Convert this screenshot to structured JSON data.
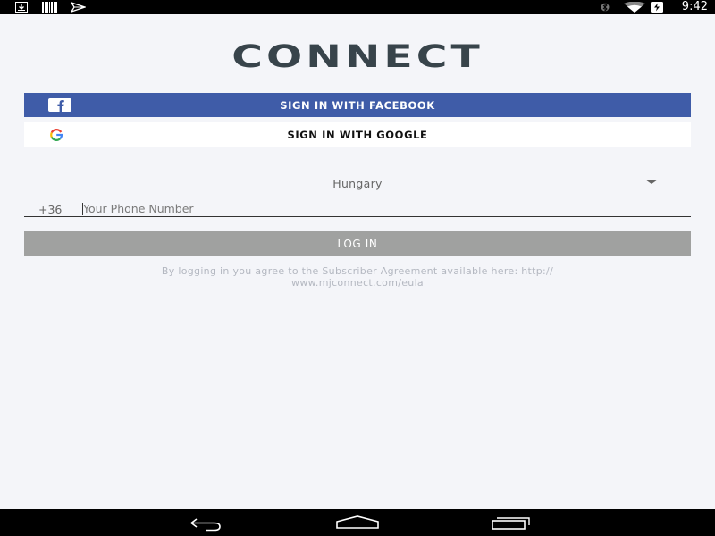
{
  "status_bar": {
    "time": "9:42",
    "left_icons": [
      "download-icon",
      "barcode-icon",
      "send-icon"
    ],
    "right_icons": [
      "bluetooth-icon",
      "wifi-icon",
      "battery-charging-icon"
    ]
  },
  "logo": {
    "text": "CONNECT"
  },
  "facebook_button": {
    "label": "SIGN IN WITH FACEBOOK",
    "icon": "facebook-icon",
    "color": "#3f5ca8"
  },
  "google_button": {
    "label": "SIGN IN WITH GOOGLE",
    "icon": "google-icon"
  },
  "country_select": {
    "value": "Hungary"
  },
  "phone": {
    "dial_code": "+36",
    "placeholder": "Your Phone Number",
    "value": ""
  },
  "login_button": {
    "label": "LOG IN",
    "color": "#a0a1a0"
  },
  "agreement": {
    "line1": "By logging in you agree to the Subscriber Agreement available here: http://",
    "line2": "www.mjconnect.com/eula"
  },
  "nav_bar": {
    "buttons": [
      "back-icon",
      "home-icon",
      "recents-icon"
    ]
  }
}
